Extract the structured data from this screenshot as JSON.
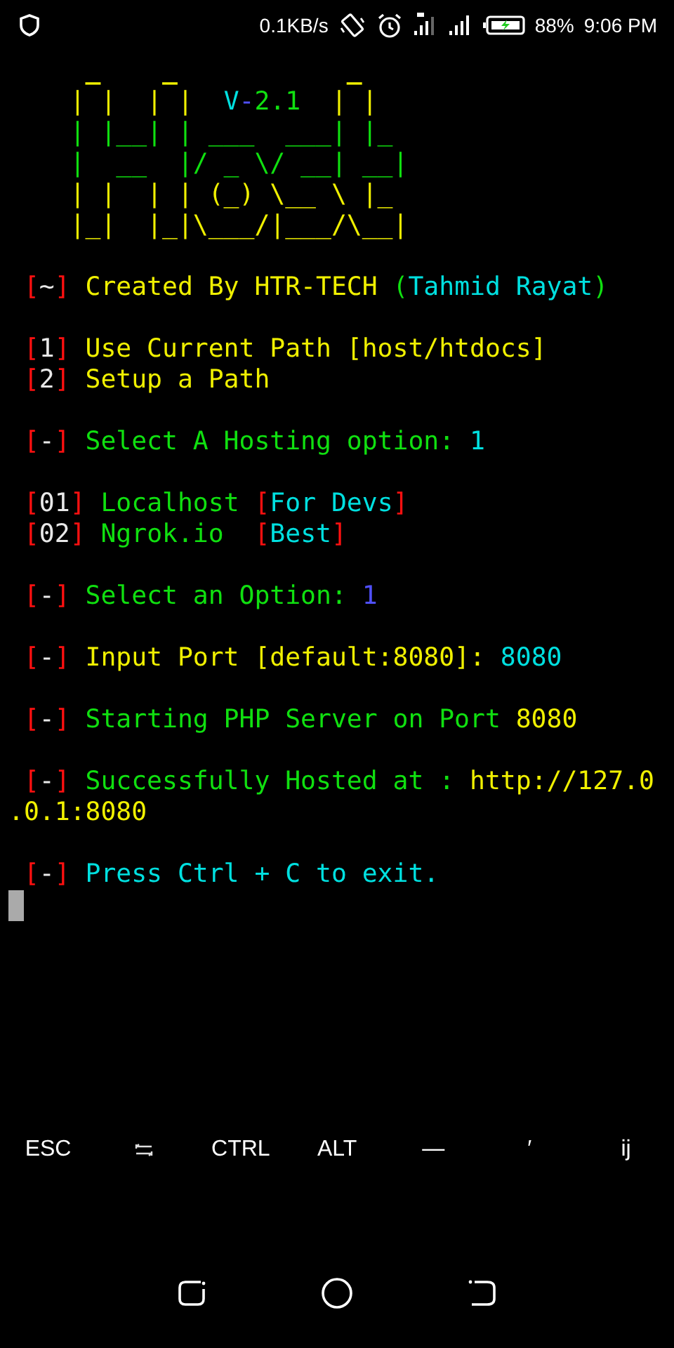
{
  "status_bar": {
    "speed": "0.1KB/s",
    "battery": "88%",
    "time": "9:06 PM"
  },
  "terminal": {
    "art": [
      [
        {
          "text": "     _    _           _",
          "color": "#f0f000"
        }
      ],
      [
        {
          "text": "    | |  | |  ",
          "color": "#f0f000"
        },
        {
          "text": "V",
          "color": "#00e0e0"
        },
        {
          "text": "-",
          "color": "#5050ff"
        },
        {
          "text": "2.1",
          "color": "#10e010"
        },
        {
          "text": "  | |",
          "color": "#f0f000"
        }
      ],
      [
        {
          "text": "    | |__| | ___  ___| |_",
          "color": "#10e010"
        }
      ],
      [
        {
          "text": "    |  __  |/ _ \\/ __| __|",
          "color": "#10e010"
        }
      ],
      [
        {
          "text": "    | |  | | (_) \\__ \\ |_",
          "color": "#f0f000"
        }
      ],
      [
        {
          "text": "    |_|  |_|\\___/|___/\\__|",
          "color": "#f0f000"
        }
      ]
    ],
    "lines": [
      {
        "kind": "blank"
      },
      {
        "kind": "text",
        "segments": [
          {
            "text": " [",
            "color": "#ff1010"
          },
          {
            "text": "~",
            "color": "#e8e8e8"
          },
          {
            "text": "]",
            "color": "#ff1010"
          },
          {
            "text": " Created By HTR-TECH ",
            "color": "#f0f000"
          },
          {
            "text": "(",
            "color": "#10e010"
          },
          {
            "text": "Tahmid Rayat",
            "color": "#00e0e0"
          },
          {
            "text": ")",
            "color": "#10e010"
          }
        ]
      },
      {
        "kind": "blank"
      },
      {
        "kind": "text",
        "segments": [
          {
            "text": " [",
            "color": "#ff1010"
          },
          {
            "text": "1",
            "color": "#e8e8e8"
          },
          {
            "text": "]",
            "color": "#ff1010"
          },
          {
            "text": " Use Current Path [host/htdocs]",
            "color": "#f0f000"
          }
        ]
      },
      {
        "kind": "text",
        "segments": [
          {
            "text": " [",
            "color": "#ff1010"
          },
          {
            "text": "2",
            "color": "#e8e8e8"
          },
          {
            "text": "]",
            "color": "#ff1010"
          },
          {
            "text": " Setup a Path",
            "color": "#f0f000"
          }
        ]
      },
      {
        "kind": "blank"
      },
      {
        "kind": "text",
        "segments": [
          {
            "text": " [",
            "color": "#ff1010"
          },
          {
            "text": "-",
            "color": "#e8e8e8"
          },
          {
            "text": "]",
            "color": "#ff1010"
          },
          {
            "text": " Select A Hosting option: ",
            "color": "#10e010"
          },
          {
            "text": "1",
            "color": "#00e0e0"
          }
        ]
      },
      {
        "kind": "blank"
      },
      {
        "kind": "text",
        "segments": [
          {
            "text": " [",
            "color": "#ff1010"
          },
          {
            "text": "01",
            "color": "#e8e8e8"
          },
          {
            "text": "]",
            "color": "#ff1010"
          },
          {
            "text": " Localhost ",
            "color": "#10e010"
          },
          {
            "text": "[",
            "color": "#ff1010"
          },
          {
            "text": "For Devs",
            "color": "#00e0e0"
          },
          {
            "text": "]",
            "color": "#ff1010"
          }
        ]
      },
      {
        "kind": "text",
        "segments": [
          {
            "text": " [",
            "color": "#ff1010"
          },
          {
            "text": "02",
            "color": "#e8e8e8"
          },
          {
            "text": "]",
            "color": "#ff1010"
          },
          {
            "text": " Ngrok.io  ",
            "color": "#10e010"
          },
          {
            "text": "[",
            "color": "#ff1010"
          },
          {
            "text": "Best",
            "color": "#00e0e0"
          },
          {
            "text": "]",
            "color": "#ff1010"
          }
        ]
      },
      {
        "kind": "blank"
      },
      {
        "kind": "text",
        "segments": [
          {
            "text": " [",
            "color": "#ff1010"
          },
          {
            "text": "-",
            "color": "#e8e8e8"
          },
          {
            "text": "]",
            "color": "#ff1010"
          },
          {
            "text": " Select an Option: ",
            "color": "#10e010"
          },
          {
            "text": "1",
            "color": "#5050ff"
          }
        ]
      },
      {
        "kind": "blank"
      },
      {
        "kind": "text",
        "segments": [
          {
            "text": " [",
            "color": "#ff1010"
          },
          {
            "text": "-",
            "color": "#e8e8e8"
          },
          {
            "text": "]",
            "color": "#ff1010"
          },
          {
            "text": " Input Port [default:8080]: ",
            "color": "#f0f000"
          },
          {
            "text": "8080",
            "color": "#00e0e0"
          }
        ]
      },
      {
        "kind": "blank"
      },
      {
        "kind": "text",
        "segments": [
          {
            "text": " [",
            "color": "#ff1010"
          },
          {
            "text": "-",
            "color": "#e8e8e8"
          },
          {
            "text": "]",
            "color": "#ff1010"
          },
          {
            "text": " Starting PHP Server on Port ",
            "color": "#10e010"
          },
          {
            "text": "8080",
            "color": "#f0f000"
          }
        ]
      },
      {
        "kind": "blank"
      },
      {
        "kind": "text",
        "segments": [
          {
            "text": " [",
            "color": "#ff1010"
          },
          {
            "text": "-",
            "color": "#e8e8e8"
          },
          {
            "text": "]",
            "color": "#ff1010"
          },
          {
            "text": " Successfully Hosted at : ",
            "color": "#10e010"
          },
          {
            "text": "http://127.0",
            "color": "#f0f000"
          }
        ]
      },
      {
        "kind": "text",
        "segments": [
          {
            "text": ".0.1:8080",
            "color": "#f0f000"
          }
        ]
      },
      {
        "kind": "blank"
      },
      {
        "kind": "text",
        "segments": [
          {
            "text": " [",
            "color": "#ff1010"
          },
          {
            "text": "-",
            "color": "#e8e8e8"
          },
          {
            "text": "]",
            "color": "#ff1010"
          },
          {
            "text": " Press Ctrl + C to exit.",
            "color": "#00e0e0"
          }
        ]
      },
      {
        "kind": "cursor"
      }
    ]
  },
  "extra_keys": [
    {
      "kind": "text",
      "label": "ESC"
    },
    {
      "kind": "tab"
    },
    {
      "kind": "text",
      "label": "CTRL"
    },
    {
      "kind": "text",
      "label": "ALT"
    },
    {
      "kind": "text",
      "label": "—"
    },
    {
      "kind": "text",
      "label": "′"
    },
    {
      "kind": "text",
      "label": "ij"
    }
  ]
}
